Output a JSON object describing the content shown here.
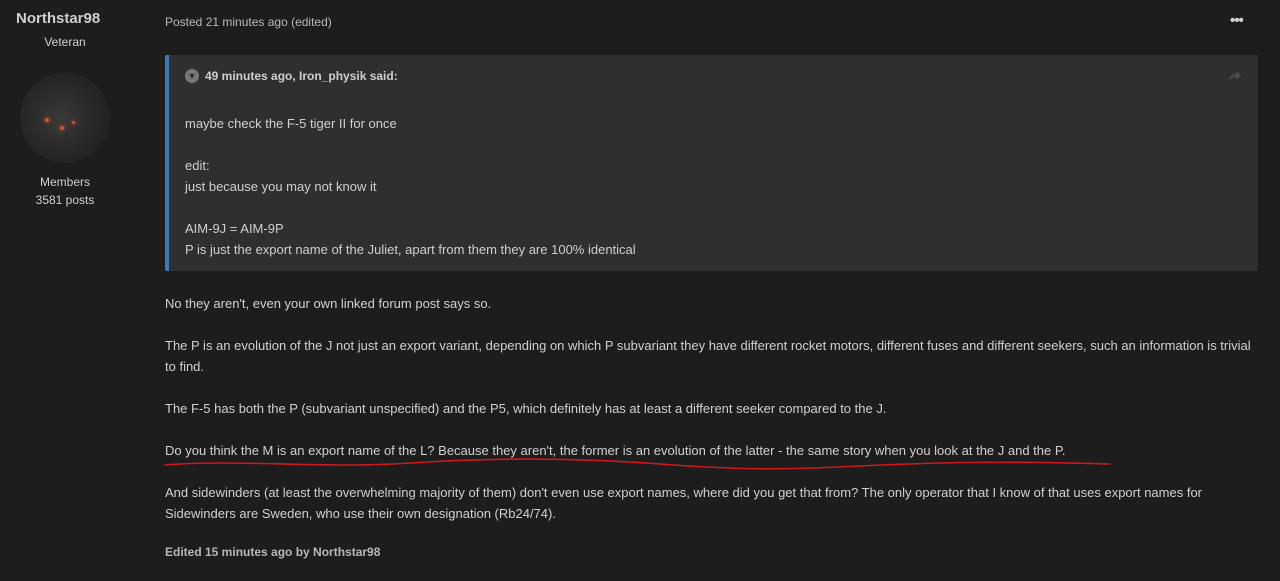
{
  "author": {
    "name": "Northstar98",
    "rank": "Veteran",
    "group": "Members",
    "posts": "3581 posts",
    "avatar_icon": "avatar-image"
  },
  "post": {
    "meta": "Posted 21 minutes ago (edited)",
    "menu_label": "•••",
    "quote": {
      "header": "49 minutes ago, Iron_physik said:",
      "lines": [
        "maybe check the F-5 tiger II for once",
        "",
        "edit:",
        "just because you may not know it",
        "",
        "AIM-9J = AIM-9P",
        "P is just the export name of the Juliet, apart from them they are 100% identical"
      ],
      "toggle_icon": "chevron-down-icon",
      "share_icon": "share-icon"
    },
    "paragraphs": [
      "No they aren't, even your own linked forum post says so.",
      "The P is an evolution of the J not just an export variant, depending on which P subvariant they have different rocket motors, different fuses and different seekers, such an information is trivial to find.",
      "The F-5 has both the P (subvariant unspecified) and the P5, which definitely has at least a different seeker compared to the J.",
      "Do you think the M is an export name of the L? Because they aren't, the former is an evolution of the latter - the same story when you look at the J and the P.",
      "And sidewinders (at least the overwhelming majority of them) don't even use export names, where did you get that from? The only operator that I know of that uses export names for Sidewinders are Sweden, who use their own designation (Rb24/74)."
    ],
    "edited_note": "Edited 15 minutes ago by Northstar98"
  },
  "colors": {
    "background": "#1d1d1d",
    "quote_background": "#2f2f2f",
    "quote_border": "#3a79c2",
    "annotation_red": "#d01818"
  }
}
